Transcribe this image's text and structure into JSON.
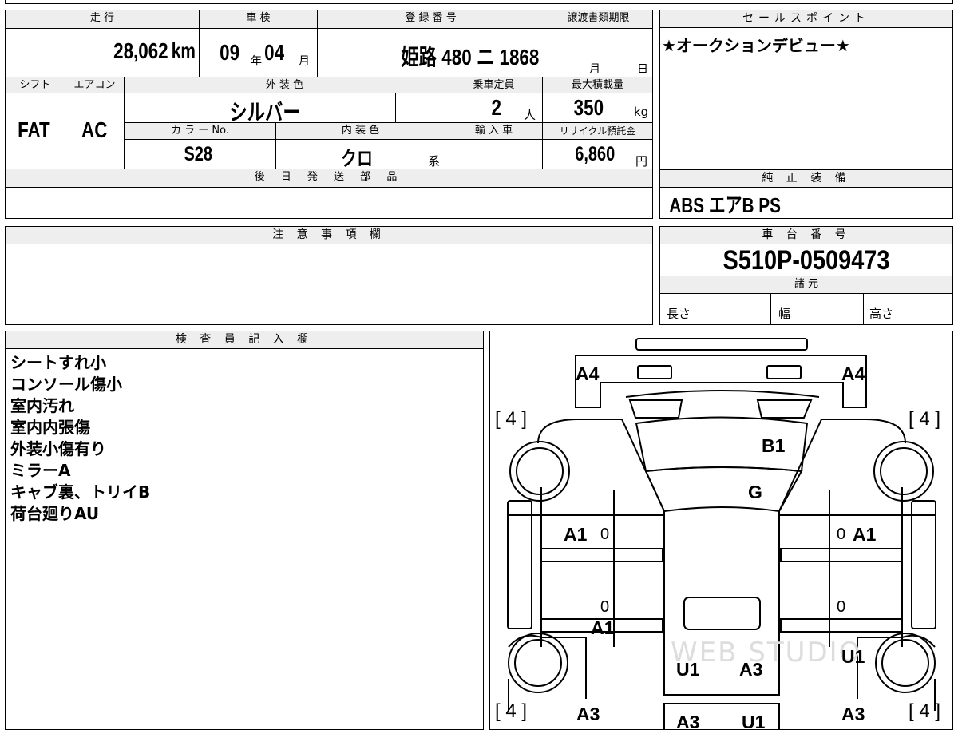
{
  "summary": {
    "mileage_label": "走 行",
    "mileage": "28,062",
    "mileage_unit": "km",
    "inspection_label": "車 検",
    "inspection_year": "09",
    "inspection_year_unit": "年",
    "inspection_month": "04",
    "inspection_month_unit": "月",
    "registration_label": "登 録 番 号",
    "registration": "姫路 480 ニ 1868",
    "transfer_deadline_label": "譲渡書類期限",
    "transfer_month_unit": "月",
    "transfer_day_unit": "日",
    "shift_label": "シフト",
    "shift": "FAT",
    "ac_label": "エアコン",
    "ac": "AC",
    "exterior_label": "外 装 色",
    "exterior_color": "シルバー",
    "capacity_label": "乗車定員",
    "capacity": "2",
    "capacity_unit": "人",
    "max_load_label": "最大積載量",
    "max_load": "350",
    "max_load_unit": "kg",
    "color_no_label": "カ ラ ー No.",
    "color_no": "S28",
    "interior_label": "内 装 色",
    "interior_color": "クロ",
    "interior_suffix": "系",
    "import_label": "輸 入 車",
    "recycle_label": "リサイクル預託金",
    "recycle_fee": "6,860",
    "recycle_unit": "円",
    "later_parts_label": "後 日 発 送 部 品"
  },
  "sales_point": {
    "label": "セールスポイント",
    "text": "★オークションデビュー★"
  },
  "standard_equipment": {
    "label": "純 正 装 備",
    "text": "ABS エアB PS"
  },
  "caution": {
    "label": "注 意 事 項 欄"
  },
  "chassis": {
    "label": "車 台 番 号",
    "number": "S510P-0509473",
    "specs_label": "諸 元",
    "length_label": "長さ",
    "width_label": "幅",
    "height_label": "高さ"
  },
  "inspector": {
    "label": "検 査 員 記 入 欄",
    "notes": [
      "シートすれ小",
      "コンソール傷小",
      "室内汚れ",
      "室内内張傷",
      "外装小傷有り",
      "ミラーA",
      "キャブ裏、トリイB",
      "荷台廻りAU"
    ]
  },
  "diagram": {
    "tire_marks": [
      "[ 4 ]",
      "[ 4 ]",
      "[ 4 ]",
      "[ 4 ]"
    ],
    "damage_codes": {
      "front_left": "A4",
      "front_right": "A4",
      "roof": "B1",
      "glass": "G",
      "left_door": "A1",
      "right_door": "A1",
      "left_lower": "A1",
      "bed_u1": "U1",
      "bed_a3": "A3",
      "right_rear": "U1",
      "rear_left": "A3",
      "rear_right": "A3",
      "tail_a": "A3",
      "tail_u": "U1"
    },
    "zeros": [
      "0",
      "0",
      "0",
      "0"
    ],
    "watermark": "WEB STUDIO"
  }
}
